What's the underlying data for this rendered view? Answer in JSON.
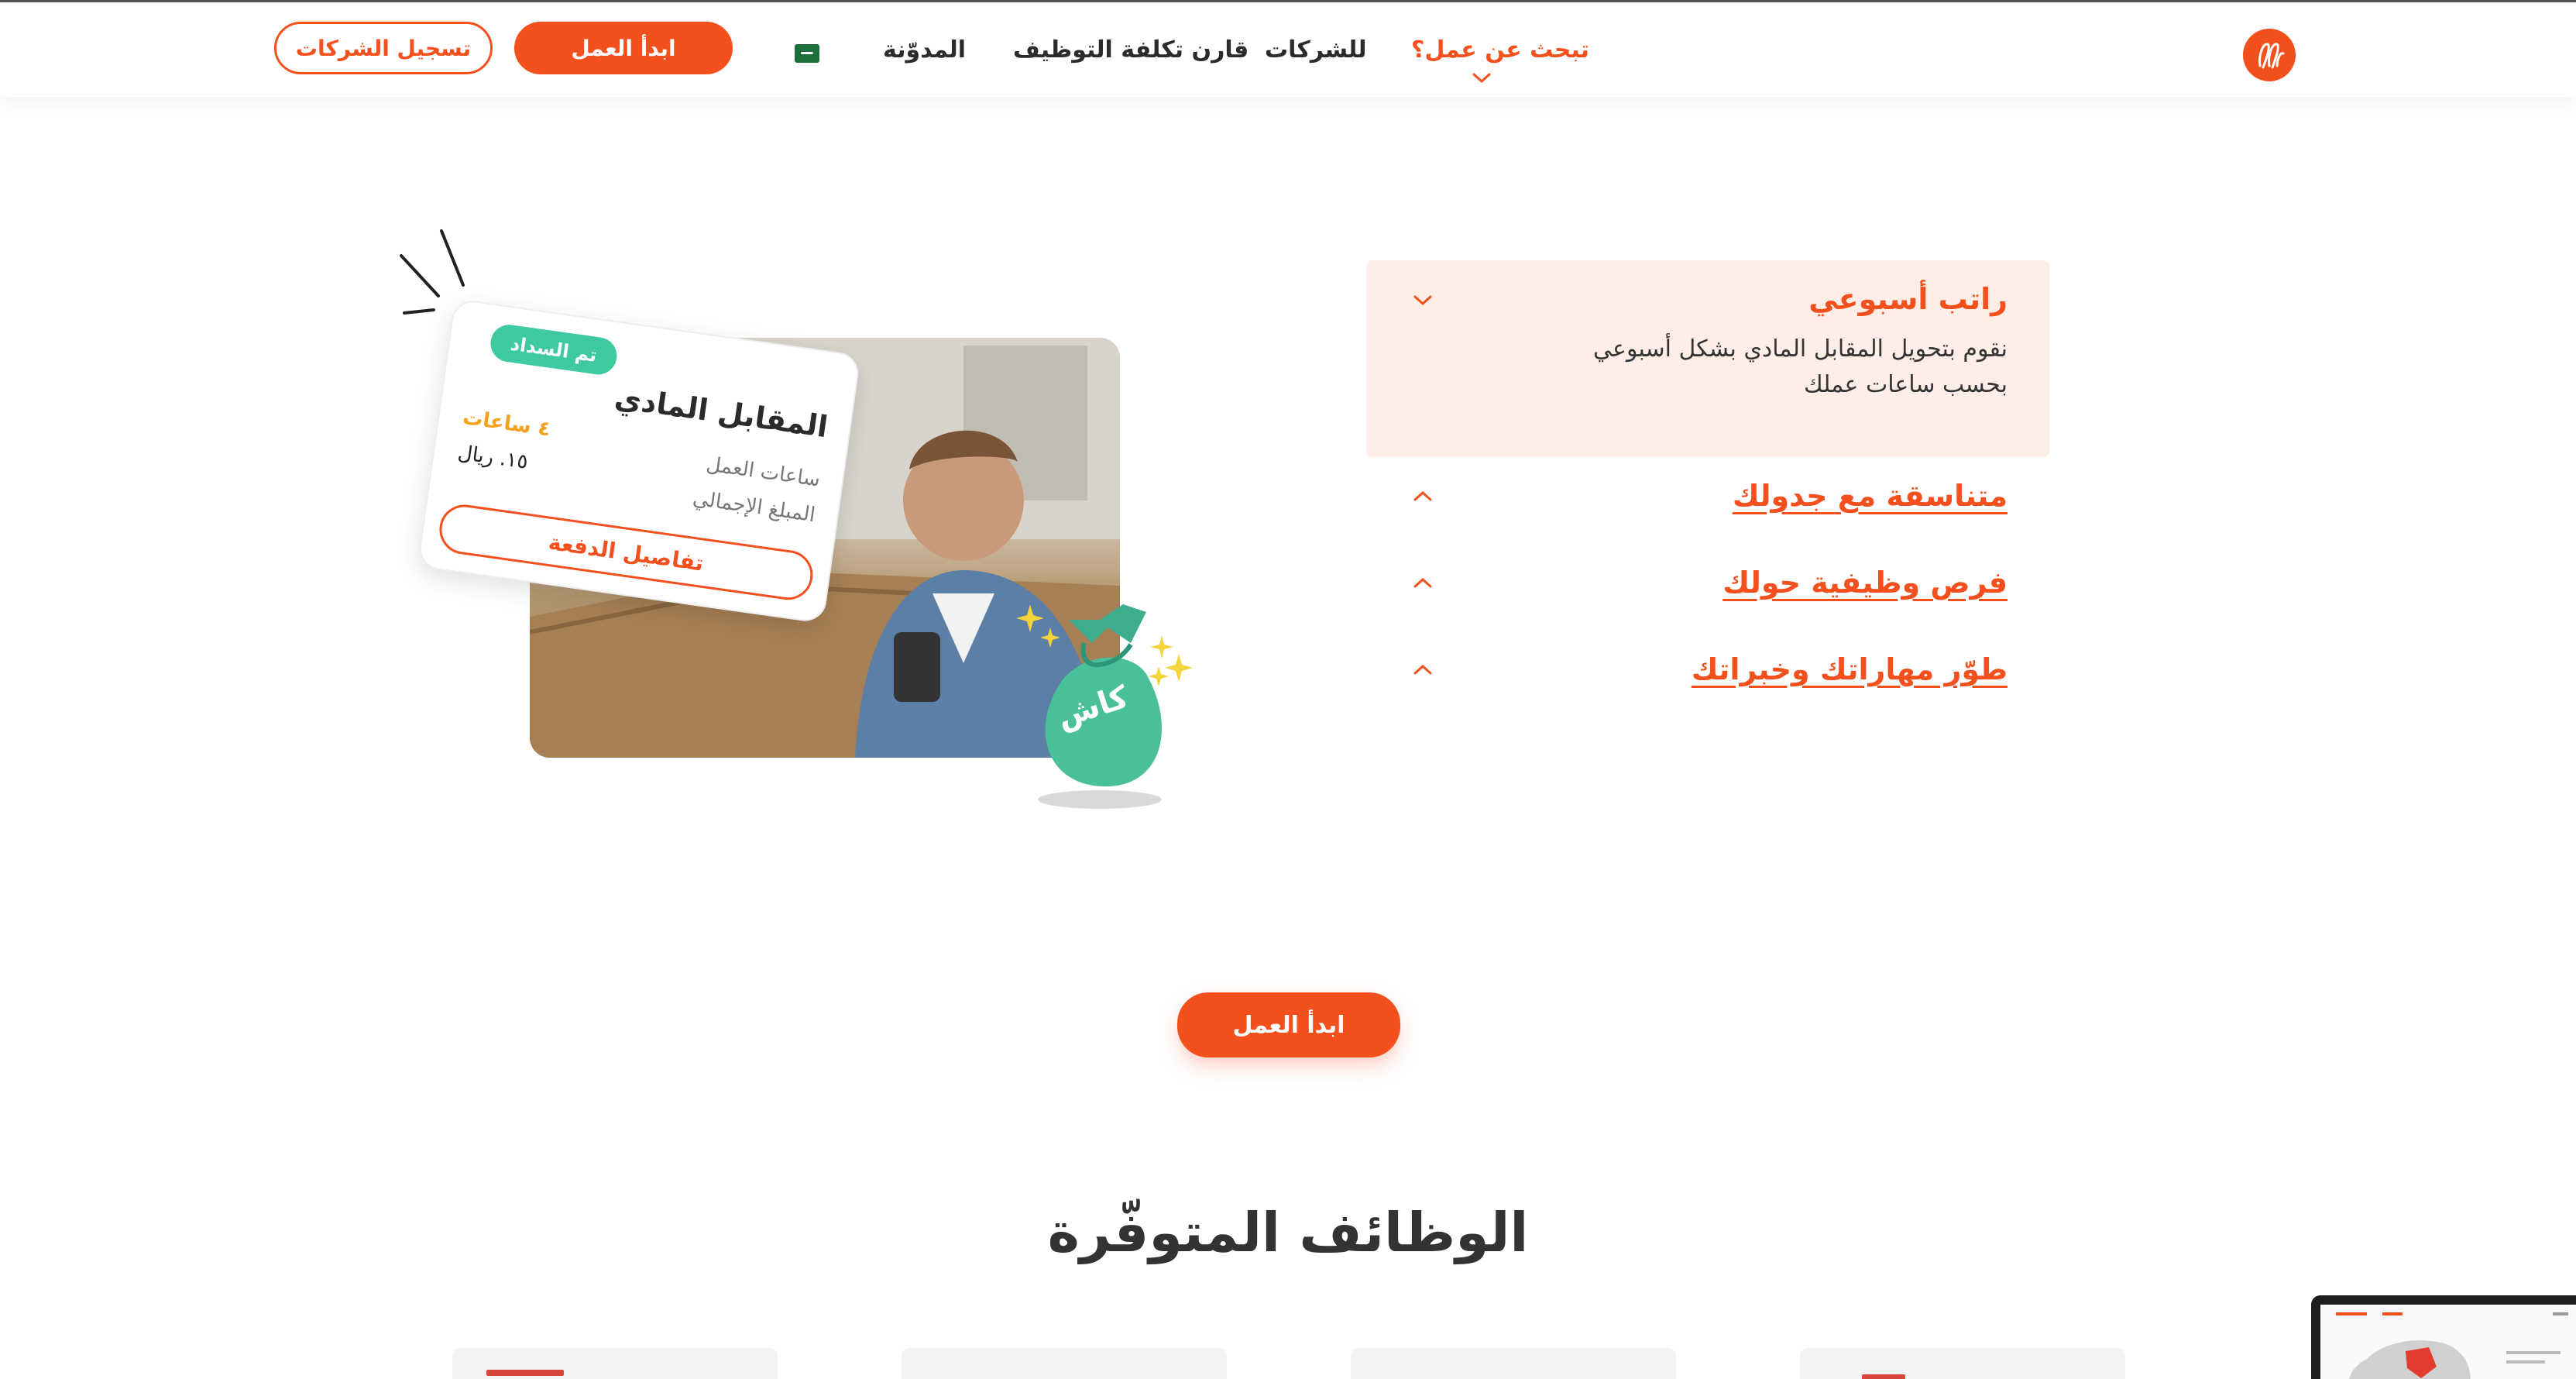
{
  "colors": {
    "accent": "#f4501e",
    "accent_soft": "#feeee7",
    "mint": "#3ec9a0",
    "gold": "#f4a21e"
  },
  "nav": {
    "looking_for_work": "تبحث عن عمل؟",
    "for_companies": "للشركات",
    "compare_cost": "قارن تكلفة التوظيف",
    "blog": "المدوّنة",
    "start_work": "ابدأ العمل",
    "register_companies": "تسجيل الشركات",
    "language_flag_icon": "saudi-flag-icon",
    "logo_icon": "brand-logo-icon"
  },
  "accordion": {
    "items": [
      {
        "title": "راتب أسبوعي",
        "body_line1": "نقوم بتحويل المقابل المادي بشكل أسبوعي",
        "body_line2": "بحسب ساعات عملك",
        "expanded": true
      },
      {
        "title": "متناسقة مع جدولك",
        "expanded": false
      },
      {
        "title": "فرص وظيفية حولك",
        "expanded": false
      },
      {
        "title": "طوّر مهاراتك وخبراتك",
        "expanded": false
      }
    ]
  },
  "illustration": {
    "paid_badge": "تم السداد",
    "card_title": "المقابل المادي",
    "hours_label": "ساعات العمل",
    "hours_value": "٤ ساعات",
    "total_label": "المبلغ الإجمالي",
    "total_value": "١٥. ريال",
    "details_button": "تفاصيل الدفعة",
    "bag_label": "كاش"
  },
  "cta": {
    "start_work": "ابدأ العمل"
  },
  "jobs_section": {
    "title": "الوظائف المتوفّرة"
  }
}
